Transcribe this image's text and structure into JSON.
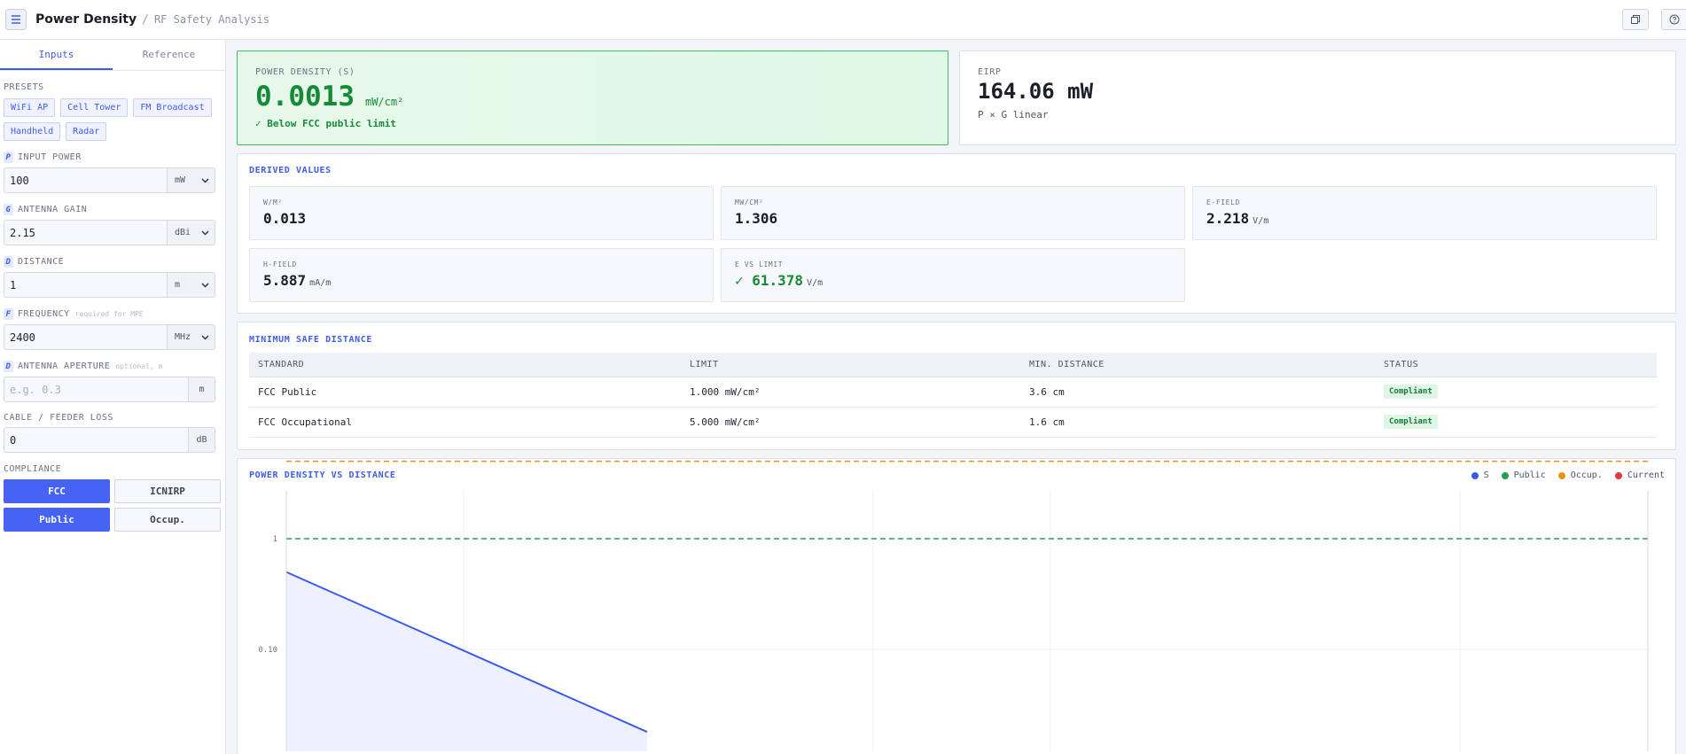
{
  "header": {
    "title": "Power Density",
    "separator": "/",
    "breadcrumb": "RF Safety Analysis"
  },
  "sidebar": {
    "tabs": [
      "Inputs",
      "Reference"
    ],
    "presets_label": "PRESETS",
    "presets": [
      "WiFi AP",
      "Cell Tower",
      "FM Broadcast",
      "Handheld",
      "Radar"
    ],
    "fields": [
      {
        "glyph": "P",
        "label": "INPUT POWER",
        "hint": "",
        "value": "100",
        "placeholder": "",
        "unit": "mW",
        "dropdown": true
      },
      {
        "glyph": "G",
        "label": "ANTENNA GAIN",
        "hint": "",
        "value": "2.15",
        "placeholder": "",
        "unit": "dBi",
        "dropdown": true
      },
      {
        "glyph": "D",
        "label": "DISTANCE",
        "hint": "",
        "value": "1",
        "placeholder": "",
        "unit": "m",
        "dropdown": true
      },
      {
        "glyph": "F",
        "label": "FREQUENCY",
        "hint": "required for MPE",
        "value": "2400",
        "placeholder": "",
        "unit": "MHz",
        "dropdown": true
      },
      {
        "glyph": "D",
        "label": "ANTENNA APERTURE",
        "hint": "optional, m",
        "value": "",
        "placeholder": "e.g. 0.3",
        "unit": "m",
        "dropdown": false
      }
    ],
    "cable": {
      "label": "CABLE / FEEDER LOSS",
      "value": "0",
      "unit": "dB"
    },
    "compliance": {
      "label": "COMPLIANCE",
      "standards": [
        "FCC",
        "ICNIRP"
      ],
      "selected_standard": "FCC",
      "populations": [
        "Public",
        "Occup."
      ],
      "selected_population": "Public"
    }
  },
  "power_density": {
    "label": "POWER DENSITY (S)",
    "value": "0.0013",
    "unit": "mW/cm²",
    "status": "✓ Below FCC public limit"
  },
  "eirp": {
    "label": "EIRP",
    "value": "164.06 mW",
    "formula": "P × G linear"
  },
  "derived": {
    "title": "DERIVED VALUES",
    "tiles": [
      {
        "label": "W/M²",
        "value": "0.013",
        "unit": ""
      },
      {
        "label": "MW/CM²",
        "value": "1.306",
        "unit": ""
      },
      {
        "label": "E-FIELD",
        "value": "2.218",
        "unit": "V/m"
      },
      {
        "label": "H-FIELD",
        "value": "5.887",
        "unit": "mA/m"
      },
      {
        "label": "E VS LIMIT",
        "value": "✓ 61.378",
        "unit": "V/m"
      }
    ]
  },
  "min_safe_distance": {
    "title": "MINIMUM SAFE DISTANCE",
    "columns": [
      "STANDARD",
      "LIMIT",
      "MIN. DISTANCE",
      "STATUS"
    ],
    "rows": [
      {
        "standard": "FCC Public",
        "limit": "1.000 mW/cm²",
        "distance": "3.6 cm",
        "status": "Compliant"
      },
      {
        "standard": "FCC Occupational",
        "limit": "5.000 mW/cm²",
        "distance": "1.6 cm",
        "status": "Compliant"
      }
    ]
  },
  "chart": {
    "title": "POWER DENSITY VS DISTANCE",
    "legend": [
      "S",
      "Public",
      "Occup.",
      "Current"
    ]
  },
  "colors": {
    "accent": "#3e5de6",
    "good": "#178a38",
    "series_s": "#3b5bf0",
    "public": "#22a34a",
    "occup": "#f0901b",
    "current": "#e03c3c"
  },
  "chart_data": {
    "type": "line",
    "title": "POWER DENSITY VS DISTANCE",
    "xlabel": "",
    "ylabel": "",
    "y_scale": "log",
    "y_ticks": [
      "1",
      "0.10"
    ],
    "y_tick_values": [
      1,
      0.1
    ],
    "grid": true,
    "legend_position": "top-right",
    "series": [
      {
        "name": "S",
        "type": "line-area",
        "x_frac": [
          0,
          0.265
        ],
        "y": [
          0.5,
          0.018
        ]
      },
      {
        "name": "Public",
        "type": "hline",
        "y": 1
      },
      {
        "name": "Occup.",
        "type": "hline",
        "y": 5
      },
      {
        "name": "Current",
        "type": "marker"
      }
    ]
  }
}
